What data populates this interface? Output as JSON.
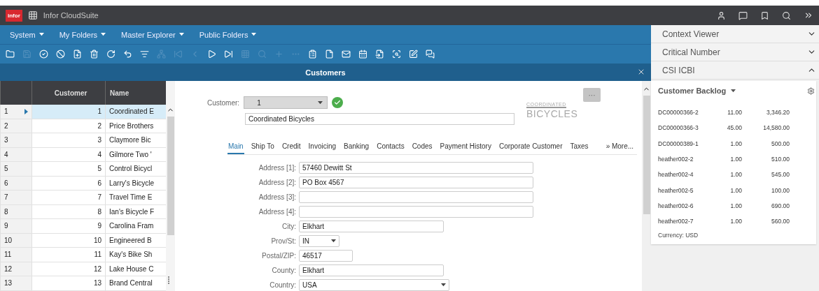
{
  "top_bar": {
    "logo": "infor",
    "title": "Infor CloudSuite"
  },
  "menu": [
    {
      "label": "System"
    },
    {
      "label": "My Folders"
    },
    {
      "label": "Master Explorer"
    },
    {
      "label": "Public Folders"
    }
  ],
  "toolbar": [
    {
      "disabled": false
    },
    {
      "disabled": true
    },
    {
      "disabled": false
    },
    {
      "disabled": false
    },
    {
      "disabled": false
    },
    {
      "disabled": false
    },
    {
      "disabled": false
    },
    {
      "disabled": false
    },
    {
      "disabled": false
    },
    {
      "disabled": true
    },
    {
      "disabled": true
    },
    {
      "disabled": true
    },
    {
      "disabled": false
    },
    {
      "disabled": false
    },
    {
      "disabled": true
    },
    {
      "disabled": true
    },
    {
      "disabled": true
    },
    {
      "disabled": true
    },
    {
      "disabled": false
    },
    {
      "disabled": false
    },
    {
      "disabled": false
    },
    {
      "disabled": false
    },
    {
      "disabled": false
    },
    {
      "disabled": false
    },
    {
      "disabled": false
    },
    {
      "disabled": false
    }
  ],
  "form_title": "Customers",
  "grid": {
    "columns": [
      "Customer",
      "Name"
    ],
    "rows": [
      {
        "num": "1",
        "customer": "1",
        "name": "Coordinated E",
        "selected": true
      },
      {
        "num": "2",
        "customer": "2",
        "name": "Price Brothers",
        "selected": false
      },
      {
        "num": "3",
        "customer": "3",
        "name": "Claymore Bic",
        "selected": false
      },
      {
        "num": "4",
        "customer": "4",
        "name": "Gilmore Two '",
        "selected": false
      },
      {
        "num": "5",
        "customer": "5",
        "name": "Control Bicycl",
        "selected": false
      },
      {
        "num": "6",
        "customer": "6",
        "name": "Larry's Bicycle",
        "selected": false
      },
      {
        "num": "7",
        "customer": "7",
        "name": "Travel Time E",
        "selected": false
      },
      {
        "num": "8",
        "customer": "8",
        "name": "Ian's Bicycle F",
        "selected": false
      },
      {
        "num": "9",
        "customer": "9",
        "name": "Carolina Fram",
        "selected": false
      },
      {
        "num": "10",
        "customer": "10",
        "name": "Engineered B",
        "selected": false
      },
      {
        "num": "11",
        "customer": "11",
        "name": "Kay's Bike Sh",
        "selected": false
      },
      {
        "num": "12",
        "customer": "12",
        "name": "Lake House C",
        "selected": false
      },
      {
        "num": "13",
        "customer": "13",
        "name": "Brand Central",
        "selected": false
      }
    ]
  },
  "form": {
    "customer_label": "Customer:",
    "customer_value": "1",
    "customer_name": "Coordinated Bicycles",
    "logo": [
      "COORDINATED",
      "BICYCLES"
    ],
    "more_button": "···",
    "tabs": [
      {
        "label": "Main",
        "selected": true
      },
      {
        "label": "Ship To",
        "selected": false
      },
      {
        "label": "Credit",
        "selected": false
      },
      {
        "label": "Invoicing",
        "selected": false
      },
      {
        "label": "Banking",
        "selected": false
      },
      {
        "label": "Contacts",
        "selected": false
      },
      {
        "label": "Codes",
        "selected": false
      },
      {
        "label": "Payment History",
        "selected": false
      },
      {
        "label": "Corporate Customer",
        "selected": false
      },
      {
        "label": "Taxes",
        "selected": false
      },
      {
        "label": "» More...",
        "selected": false
      }
    ],
    "fields": [
      {
        "label": "Address [1]:",
        "value": "57460 Dewitt St",
        "kind": "wide"
      },
      {
        "label": "Address [2]:",
        "value": "PO Box 4567",
        "kind": "wide"
      },
      {
        "label": "Address [3]:",
        "kind": "wide"
      },
      {
        "label": "Address [4]:",
        "kind": "wide"
      },
      {
        "label": "City:",
        "value": "Elkhart",
        "kind": "medium"
      },
      {
        "label": "Prov/St:",
        "value": "IN",
        "kind": "select-small"
      },
      {
        "label": "Postal/ZIP:",
        "value": "46517",
        "kind": "small"
      },
      {
        "label": "County:",
        "value": "Elkhart",
        "kind": "medium"
      },
      {
        "label": "Country:",
        "value": "USA",
        "kind": "select-medium"
      }
    ]
  },
  "side_panel": {
    "sections": [
      {
        "title": "Context Viewer",
        "expanded": false
      },
      {
        "title": "Critical Number",
        "expanded": false
      },
      {
        "title": "CSI ICBI",
        "expanded": true
      }
    ],
    "backlog": {
      "title": "Customer Backlog",
      "rows": [
        [
          "DC00000366-2",
          "11.00",
          "3,346.20"
        ],
        [
          "DC00000366-3",
          "45.00",
          "14,580.00"
        ],
        [
          "DC00000389-1",
          "1.00",
          "500.00"
        ],
        [
          "heather002-2",
          "1.00",
          "510.00"
        ],
        [
          "heather002-4",
          "1.00",
          "545.00"
        ],
        [
          "heather002-5",
          "1.00",
          "100.00"
        ],
        [
          "heather002-6",
          "1.00",
          "690.00"
        ],
        [
          "heather002-7",
          "1.00",
          "560.00"
        ]
      ],
      "currency": "Currency:  USD"
    }
  }
}
